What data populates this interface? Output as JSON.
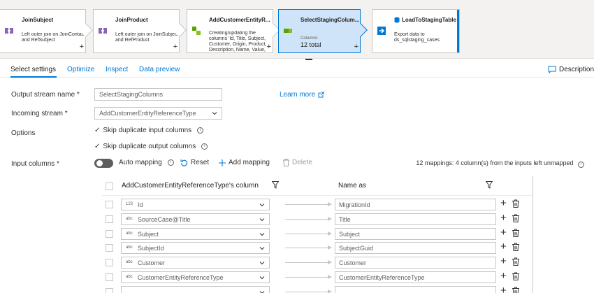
{
  "pipeline": {
    "nodes": [
      {
        "title": "JoinSubject",
        "desc": "Left outer join on JoinContact and RefSubject"
      },
      {
        "title": "JoinProduct",
        "desc": "Left outer join on JoinSubject and RefProduct"
      },
      {
        "title": "AddCustomerEntityR...",
        "desc": "Creating/updating the columns 'Id, Title, Subject, Customer, Origin, Product, Description, Name, Value,"
      },
      {
        "title": "SelectStagingColum...",
        "sub": "Columns:",
        "total": "12 total"
      },
      {
        "title": "LoadToStagingTable",
        "desc": "Export data to ds_sqlstaging_cases"
      }
    ],
    "plus": "+"
  },
  "tabs": [
    {
      "label": "Select settings"
    },
    {
      "label": "Optimize"
    },
    {
      "label": "Inspect"
    },
    {
      "label": "Data preview"
    }
  ],
  "description_label": "Description",
  "form": {
    "output_stream_label": "Output stream name *",
    "output_stream_value": "SelectStagingColumns",
    "learn_more": "Learn more",
    "incoming_stream_label": "Incoming stream *",
    "incoming_stream_value": "AddCustomerEntityReferenceType",
    "options_label": "Options",
    "skip_input": "Skip duplicate input columns",
    "skip_output": "Skip duplicate output columns",
    "checkmark": "✓",
    "input_columns_label": "Input columns *",
    "info_glyph": "i"
  },
  "toolbar": {
    "auto_mapping": "Auto mapping",
    "reset": "Reset",
    "add_mapping": "Add mapping",
    "delete": "Delete",
    "mapping_summary": "12 mappings: 4 column(s) from the inputs left unmapped"
  },
  "table": {
    "source_header": "AddCustomerEntityReferenceType's column",
    "target_header": "Name as",
    "plus": "+",
    "rows": [
      {
        "type": "123",
        "source": "Id",
        "target": "MigrationId"
      },
      {
        "type": "abc",
        "source": "SourceCase@Title",
        "target": "Title"
      },
      {
        "type": "abc",
        "source": "Subject",
        "target": "Subject"
      },
      {
        "type": "abc",
        "source": "SubjectId",
        "target": "SubjectGuid"
      },
      {
        "type": "abc",
        "source": "Customer",
        "target": "Customer"
      },
      {
        "type": "abc",
        "source": "CustomerEntityReferenceType",
        "target": "CustomerEntityReferenceType"
      },
      {
        "type": "",
        "source": "",
        "target": ""
      }
    ]
  },
  "colors": {
    "accent": "#0078d4",
    "selected_node": "#cfe4f8"
  }
}
